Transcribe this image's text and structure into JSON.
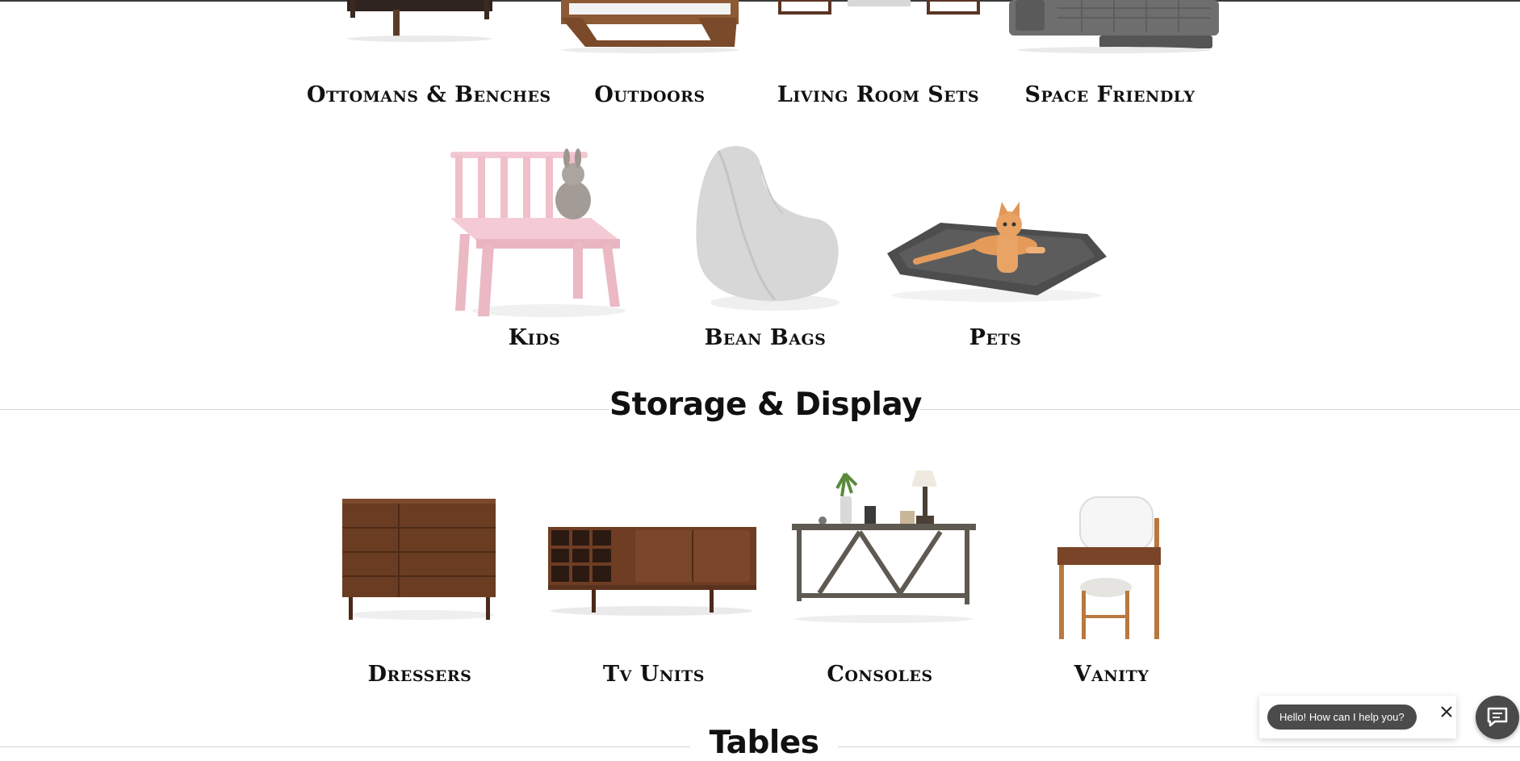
{
  "categories_row1": [
    {
      "label": "Ottomans & Benches"
    },
    {
      "label": "Outdoors"
    },
    {
      "label": "Living Room Sets"
    },
    {
      "label": "Space Friendly"
    }
  ],
  "categories_row2": [
    {
      "label": "Kids"
    },
    {
      "label": "Bean Bags"
    },
    {
      "label": "Pets"
    }
  ],
  "storage_section": {
    "title": "Storage & Display",
    "items": [
      {
        "label": "Dressers"
      },
      {
        "label": "Tv Units"
      },
      {
        "label": "Consoles"
      },
      {
        "label": "Vanity"
      }
    ]
  },
  "tables_section": {
    "title": "Tables"
  },
  "chat": {
    "greeting": "Hello! How can I help you?"
  },
  "colors": {
    "text": "#111111",
    "divider": "#d4d4d4",
    "chat_bubble": "#4b4b4b",
    "wood": "#6e3f24",
    "kids_pink": "#f1c4cf"
  }
}
